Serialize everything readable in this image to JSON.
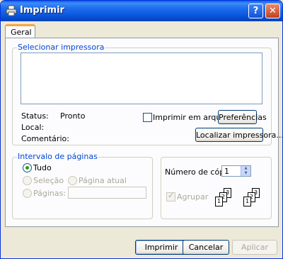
{
  "window": {
    "title": "Imprimir",
    "icons": [
      "printer-icon",
      "help-icon",
      "close-icon"
    ],
    "accent": "#0a5fe7"
  },
  "tabs": [
    {
      "label": "Geral",
      "active": true
    }
  ],
  "select_printer": {
    "label": "Selecionar impressora",
    "status_label": "Status:",
    "status_value": "Pronto",
    "location_label": "Local:",
    "comment_label": "Comentário:",
    "print_to_file_label": "Imprimir em arquivo",
    "print_to_file_checked": false,
    "preferences_label": "Preferências",
    "find_printer_label": "Localizar impressora..."
  },
  "page_range": {
    "label": "Intervalo de páginas",
    "all_label": "Tudo",
    "selection_label": "Seleção",
    "current_page_label": "Página atual",
    "pages_label": "Páginas:",
    "pages_value": "",
    "selected": "all"
  },
  "copies": {
    "label": "Número de cópias:",
    "value": "1",
    "collate_label": "Agrupar",
    "collate_checked": true
  },
  "buttons": {
    "print": "Imprimir",
    "cancel": "Cancelar",
    "apply": "Aplicar"
  },
  "page_numbers": {
    "one": "1",
    "two": "2",
    "three": "3"
  }
}
